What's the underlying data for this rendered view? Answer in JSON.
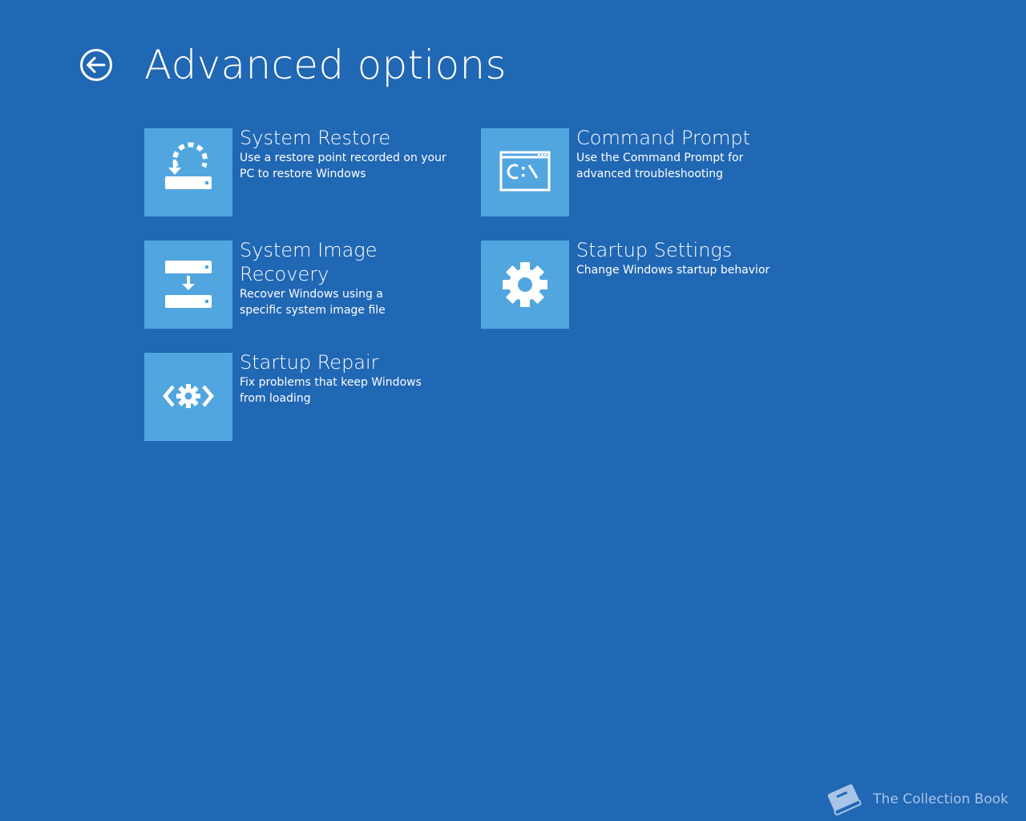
{
  "colors": {
    "background": "#2067b4",
    "tile": "#52a6e0",
    "foreground": "#ffffff",
    "watermark": "#a8c4e6"
  },
  "header": {
    "back_icon": "back-arrow-circle-icon",
    "title": "Advanced options"
  },
  "options": [
    {
      "icon": "system-restore-icon",
      "title": "System Restore",
      "description": "Use a restore point recorded on your PC to restore Windows"
    },
    {
      "icon": "command-prompt-icon",
      "title": "Command Prompt",
      "description": "Use the Command Prompt for advanced troubleshooting"
    },
    {
      "icon": "system-image-recovery-icon",
      "title": "System Image Recovery",
      "description": "Recover Windows using a specific system image file"
    },
    {
      "icon": "gear-icon",
      "title": "Startup Settings",
      "description": "Change Windows startup behavior"
    },
    {
      "icon": "startup-repair-icon",
      "title": "Startup Repair",
      "description": "Fix problems that keep Windows from loading"
    }
  ],
  "watermark": {
    "icon": "book-icon",
    "text": "The Collection Book"
  }
}
